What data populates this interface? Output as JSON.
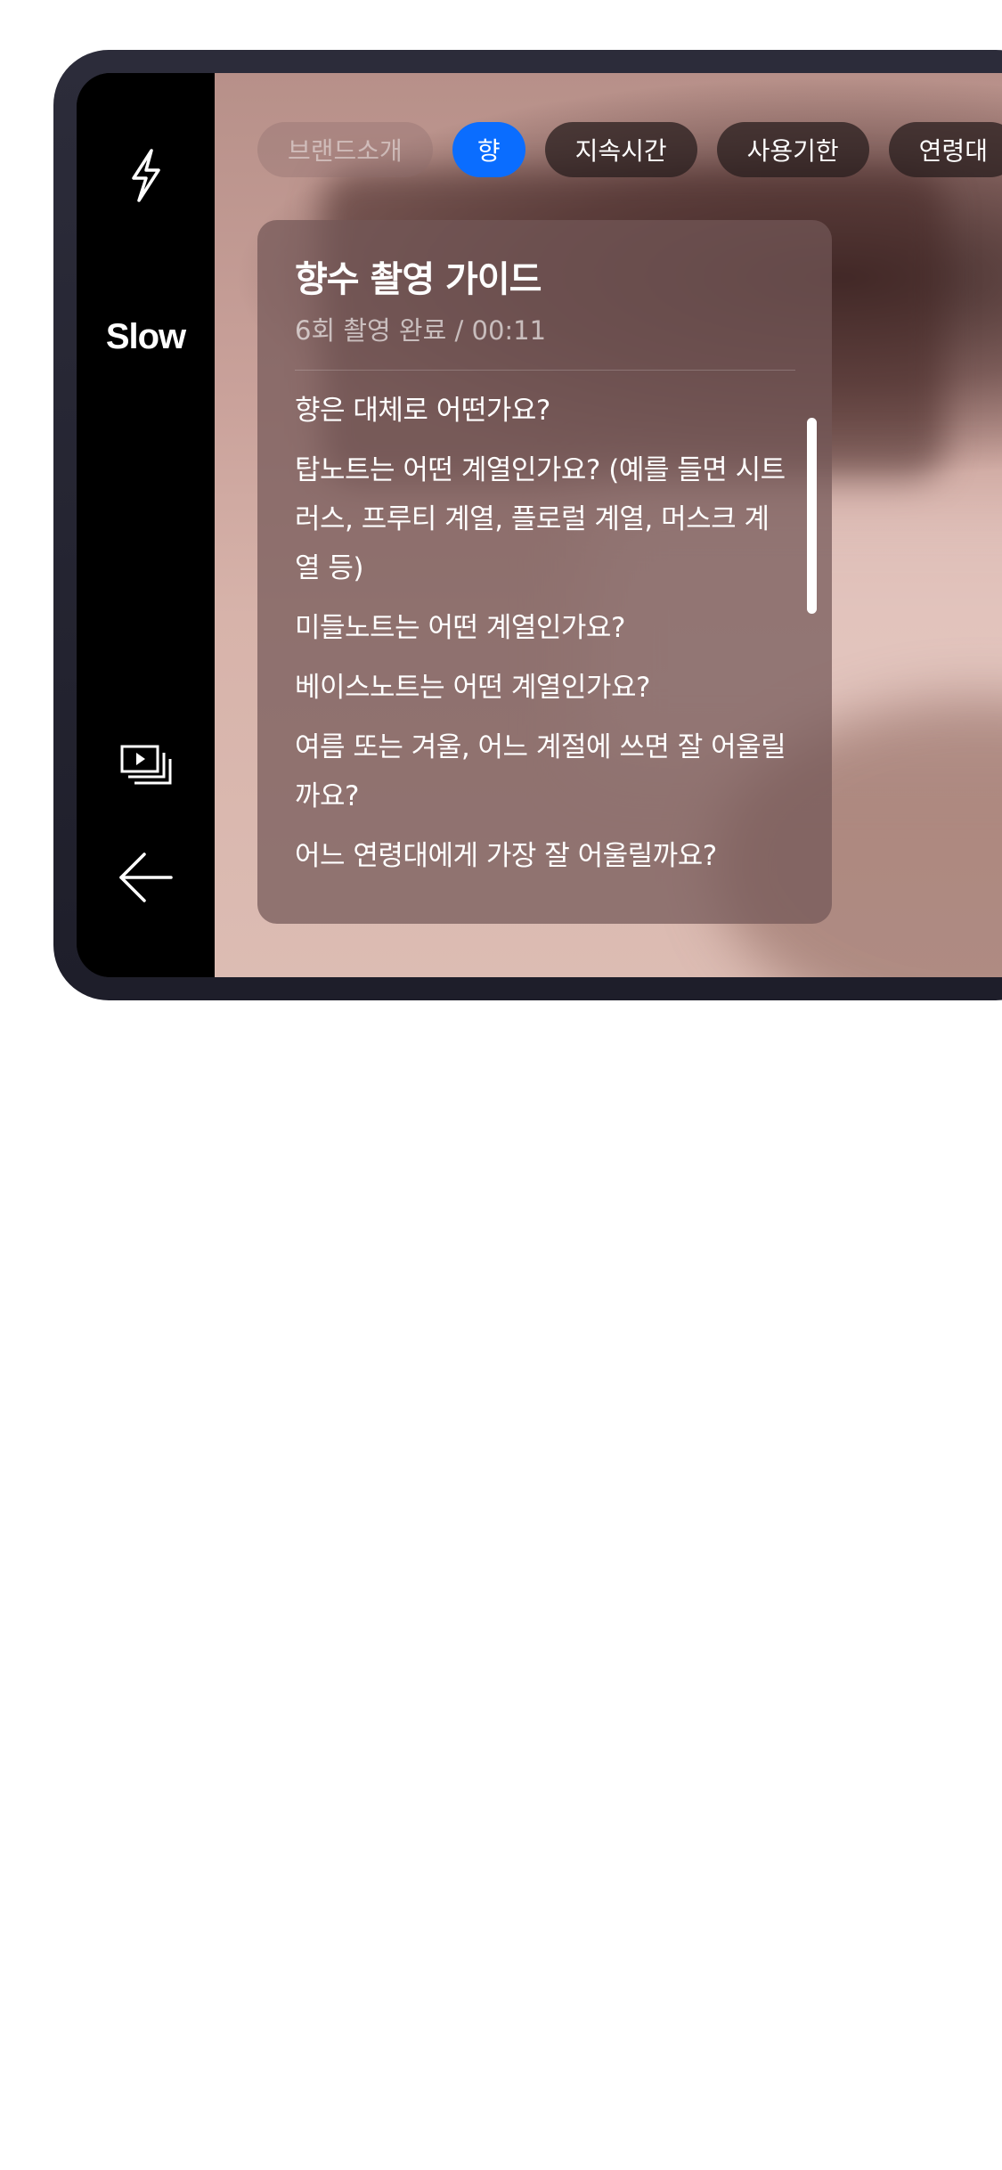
{
  "sidebar": {
    "flash_icon": "flash-icon",
    "speed_label": "Slow",
    "gallery_icon": "gallery-icon",
    "back_icon": "back-arrow-icon"
  },
  "chips": [
    {
      "label": "브랜드소개",
      "state": "disabled"
    },
    {
      "label": "향",
      "state": "active"
    },
    {
      "label": "지속시간",
      "state": "normal"
    },
    {
      "label": "사용기한",
      "state": "normal"
    },
    {
      "label": "연령대",
      "state": "normal"
    }
  ],
  "guide": {
    "title": "향수 촬영 가이드",
    "subtitle": "6회 촬영 완료 / 00:11",
    "questions": [
      "향은 대체로 어떤가요?",
      "탑노트는 어떤 계열인가요? (예를 들면 시트러스, 프루티 계열, 플로럴 계열, 머스크 계열 등)",
      "미들노트는 어떤 계열인가요?",
      "베이스노트는 어떤 계열인가요?",
      "여름 또는 겨울, 어느 계절에 쓰면 잘 어울릴까요?",
      "어느 연령대에게 가장 잘 어울릴까요?"
    ]
  },
  "colors": {
    "accent": "#0a6dff",
    "sidebar_bg": "#000000",
    "device_frame": "#2c2c3a"
  }
}
